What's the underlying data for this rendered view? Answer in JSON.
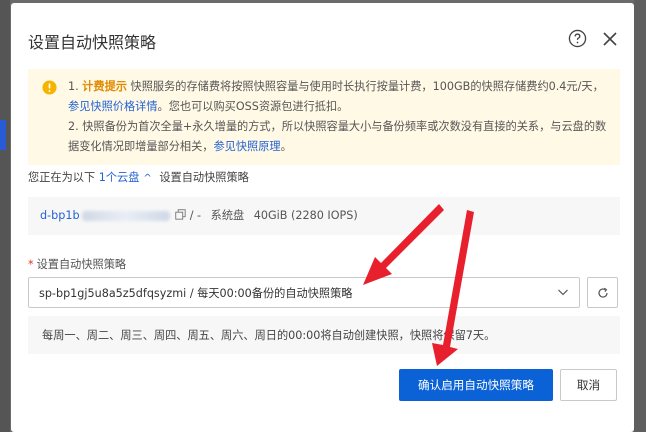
{
  "dialog": {
    "title": "设置自动快照策略"
  },
  "notice": {
    "line1_prefix": "1. ",
    "line1_bold": "计费提示",
    "line1_text": " 快照服务的存储费将按照快照容量与使用时长执行按量计费，100GB的快照存储费约0.4元/天，",
    "line1_link": "参见快照价格详情",
    "line1_suffix": "。您也可以购买OSS资源包进行抵扣。",
    "line2_text": "2. 快照备份为首次全量+永久增量的方式，所以快照容量大小与备份频率或次数没有直接的关系，与云盘的数据变化情况即增量部分相关，",
    "line2_link": "参见快照原理",
    "line2_suffix": "。"
  },
  "target": {
    "prefix": "您正在为以下",
    "link": "1个云盘",
    "suffix": "设置自动快照策略"
  },
  "disk": {
    "id": "d-bp1b",
    "sep": "/ -",
    "type": "系统盘",
    "spec": "40GiB (2280 IOPS)"
  },
  "policy": {
    "label": "设置自动快照策略",
    "selected": "sp-bp1gj5u8a5z5dfqsyzmi / 每天00:00备份的自动快照策略",
    "description": "每周一、周二、周三、周四、周五、周六、周日的00:00将自动创建快照，快照将保留7天。"
  },
  "buttons": {
    "confirm": "确认启用自动快照策略",
    "cancel": "取消"
  },
  "colors": {
    "primary": "#0b62d6",
    "link": "#2462d4",
    "warning": "#e08a00",
    "annotation": "#e8202e"
  }
}
